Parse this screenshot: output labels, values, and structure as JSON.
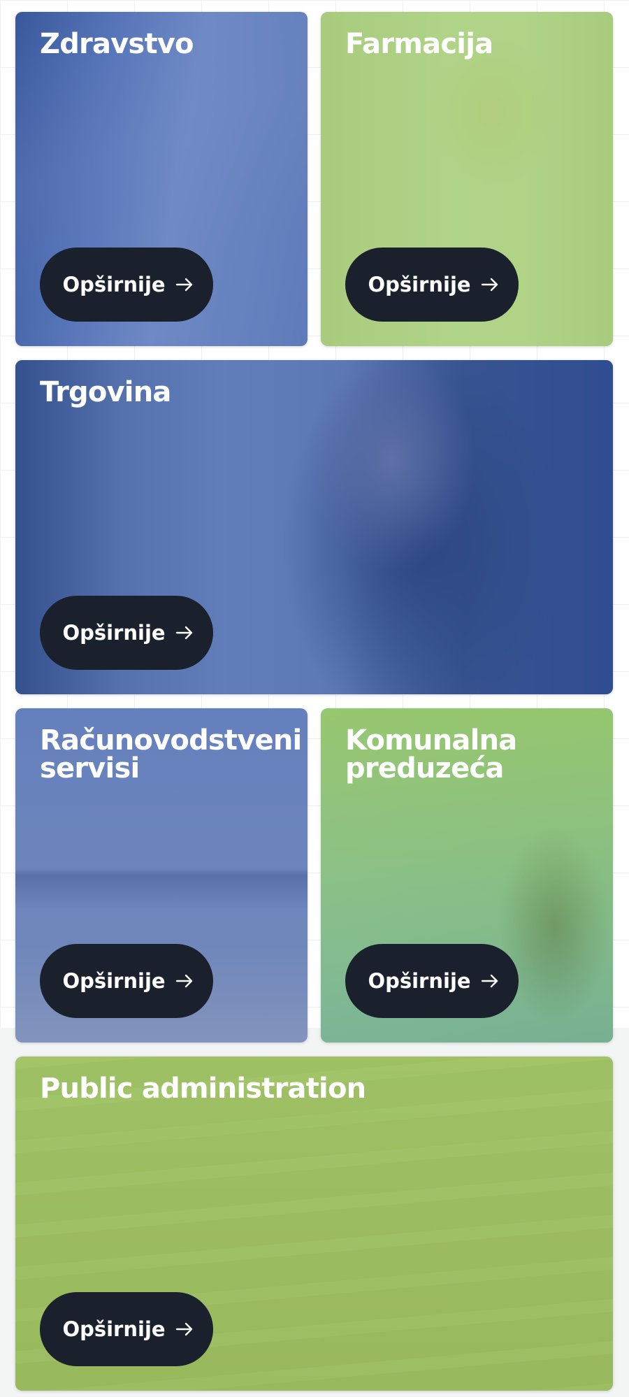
{
  "cards": [
    {
      "title": "Zdravstvo",
      "button_label": "Opširnije"
    },
    {
      "title": "Farmacija",
      "button_label": "Opširnije"
    },
    {
      "title": "Trgovina",
      "button_label": "Opširnije"
    },
    {
      "title_lines": [
        "Računovodstveni",
        "servisi"
      ],
      "button_label": "Opširnije"
    },
    {
      "title_lines": [
        "Komunalna",
        "preduzeća"
      ],
      "button_label": "Opširnije"
    },
    {
      "title": "Public administration",
      "button_label": "Opširnije"
    }
  ],
  "icons": {
    "button_arrow": "arrow-right-icon"
  },
  "colors": {
    "button_bg": "#1a202c",
    "overlay_blue": "#3e62b2",
    "overlay_green": "#96c85f",
    "title_text": "#ffffff"
  }
}
